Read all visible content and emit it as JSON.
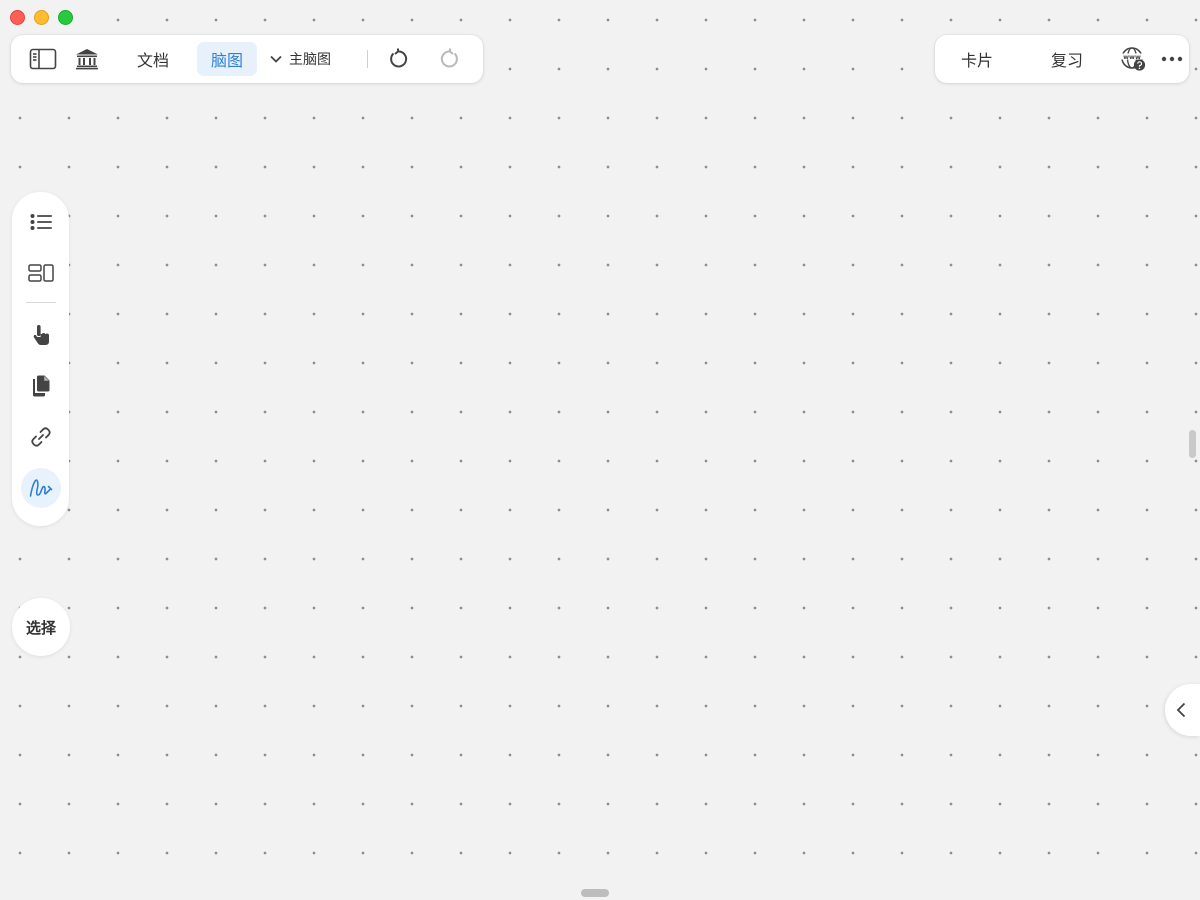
{
  "window": {
    "controls": [
      "close",
      "minimize",
      "maximize"
    ],
    "colors": {
      "close": "#ff5f57",
      "minimize": "#febc2e",
      "maximize": "#28c840"
    }
  },
  "toolbar_left": {
    "sidebar_toggle_icon": "sidebar-toggle-icon",
    "library_icon": "library-icon",
    "doc_tab": "文档",
    "mindmap_tab": "脑图",
    "active_tab": "脑图",
    "map_select": "主脑图",
    "undo_icon": "undo-icon",
    "redo_icon": "redo-icon"
  },
  "toolbar_right": {
    "card_label": "卡片",
    "review_label": "复习",
    "web_help_icon": "web-help-icon",
    "more_icon": "more-icon",
    "web_icon_text": "www"
  },
  "side_tools": {
    "items": [
      {
        "icon": "outline-list-icon"
      },
      {
        "icon": "layout-icon"
      },
      {
        "icon": "pointer-hand-icon"
      },
      {
        "icon": "document-copy-icon"
      },
      {
        "icon": "link-icon"
      },
      {
        "icon": "draw-pen-icon",
        "active": true
      }
    ],
    "select_label": "选择"
  },
  "colors": {
    "accent": "#2f7fd6",
    "active_bg": "#e6f1fb",
    "canvas_bg": "#f2f2f2",
    "dot": "#8d8d8d"
  }
}
